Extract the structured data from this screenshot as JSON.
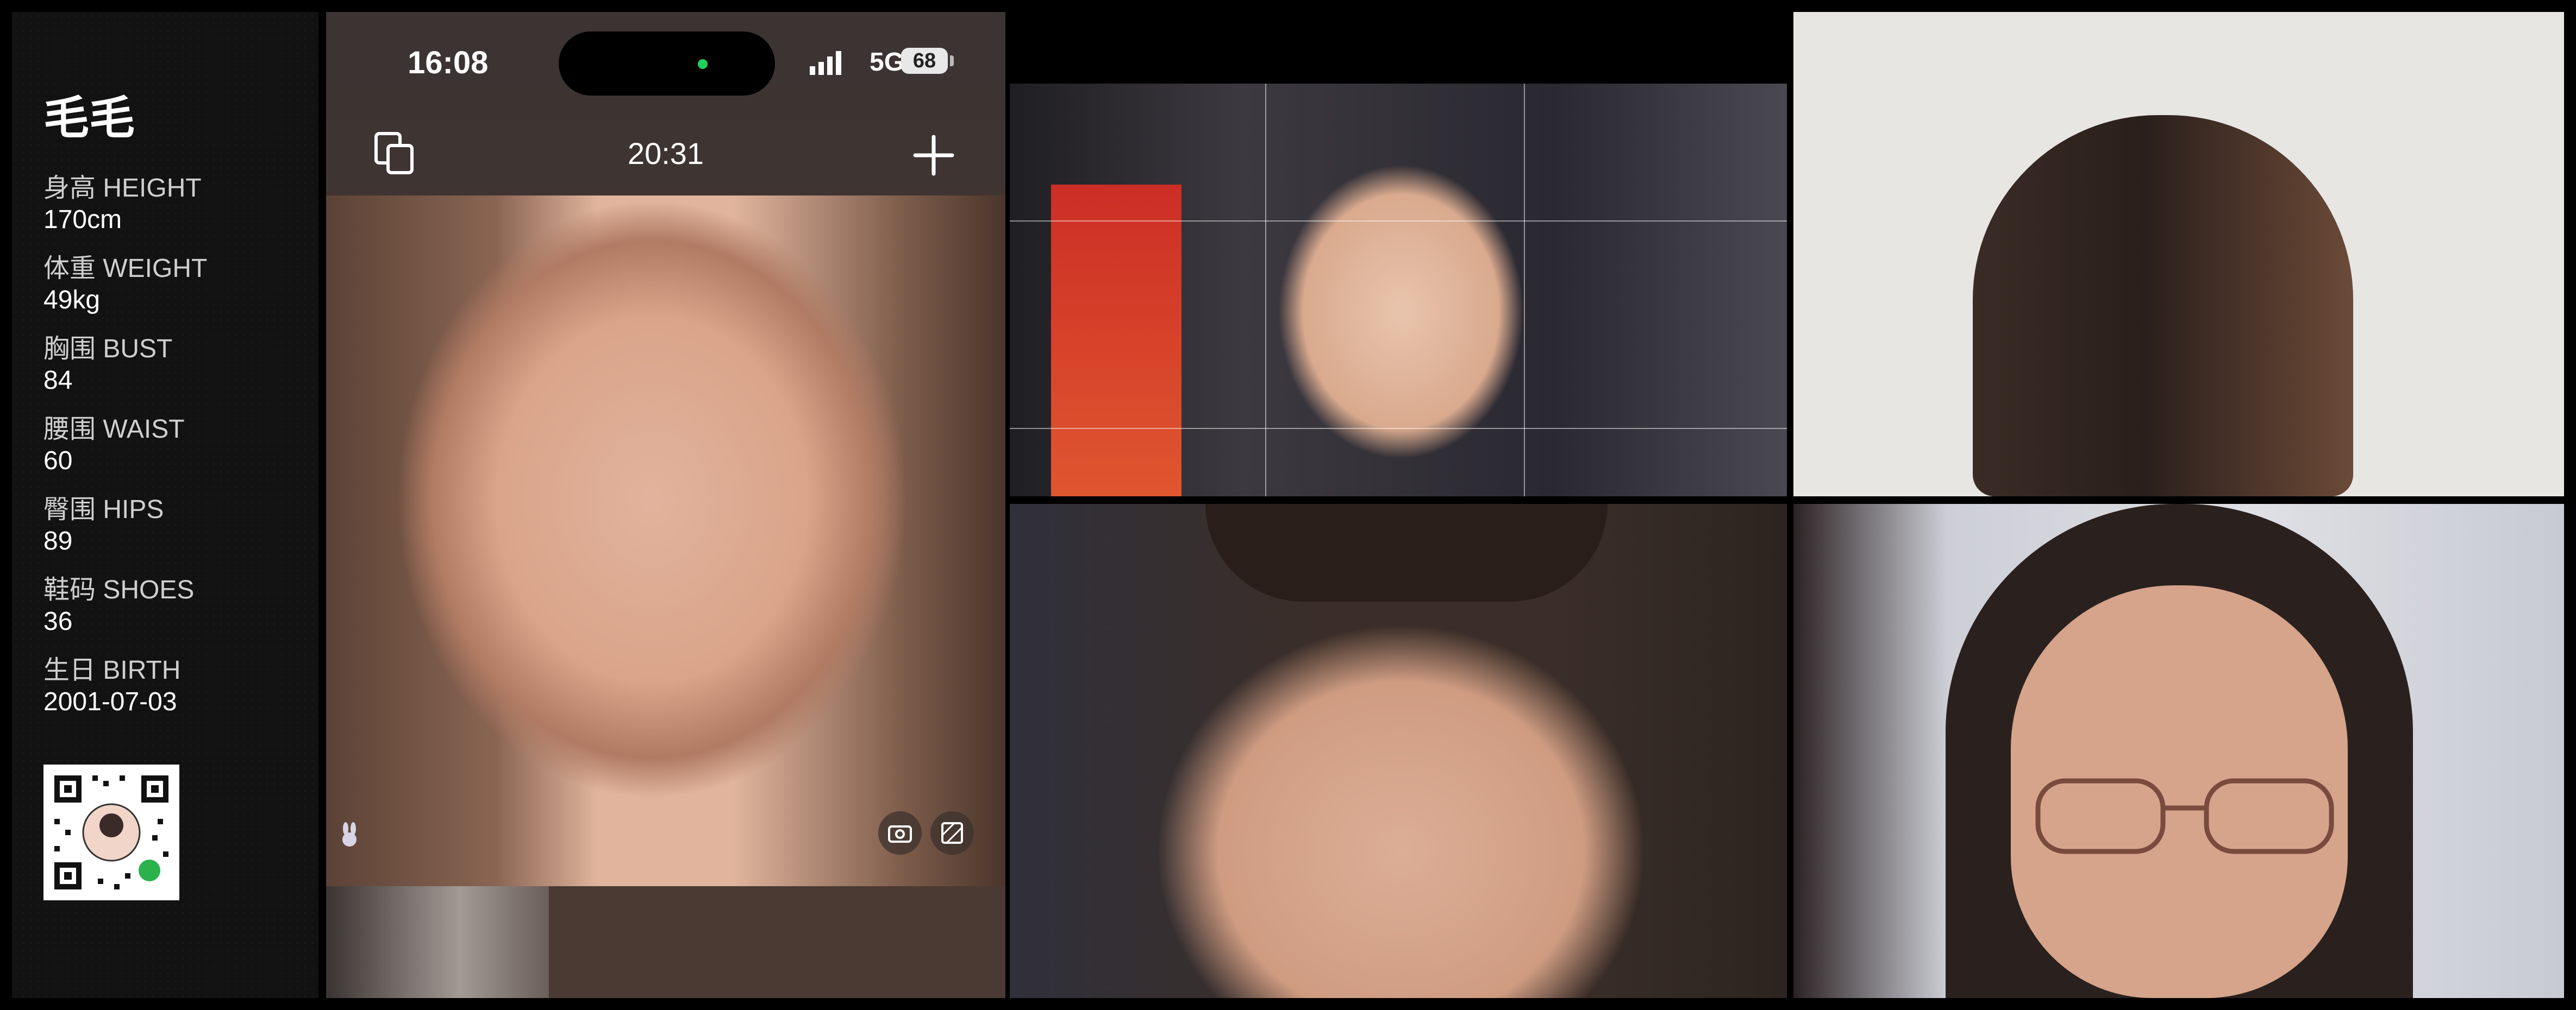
{
  "profile": {
    "name": "毛毛",
    "stats": [
      {
        "label": "身高 HEIGHT",
        "value": "170cm"
      },
      {
        "label": "体重 WEIGHT",
        "value": "49kg"
      },
      {
        "label": "胸围 BUST",
        "value": "84"
      },
      {
        "label": "腰围 WAIST",
        "value": "60"
      },
      {
        "label": "臀围 HIPS",
        "value": "89"
      },
      {
        "label": "鞋码 SHOES",
        "value": "36"
      },
      {
        "label": "生日 BIRTH",
        "value": "2001-07-03"
      }
    ],
    "qr_icon": "qr-code-icon"
  },
  "phone": {
    "status_time": "16:08",
    "network": "5G",
    "battery": "68",
    "camera_timer": "20:31",
    "icons": [
      "copy-icon",
      "plus-icon",
      "flip-camera-icon",
      "filter-icon",
      "rabbit-icon"
    ]
  },
  "colors": {
    "panel_bg": "#121212",
    "phone_bg": "#3f3431",
    "camera_dot": "#1fd05a"
  }
}
